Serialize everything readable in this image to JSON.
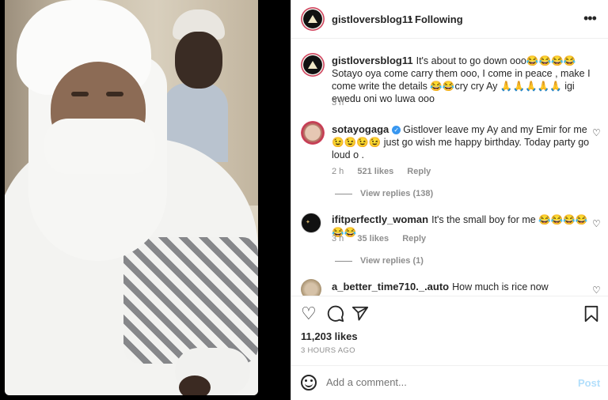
{
  "post": {
    "username": "gistloversblog11",
    "separator": "•",
    "follow_status": "Following",
    "more_icon": "more-horizontal-icon"
  },
  "caption": {
    "username": "gistloversblog11",
    "text": "It's about to go down ooo😂😂😂😂 Sotayo oya come carry them ooo, I come in peace , make I come write the details 😂😂cry cry Ay 🙏🙏🙏🙏🙏 igi ewedu oni wo luwa ooo",
    "time": "3 h"
  },
  "comments": [
    {
      "username": "sotayogaga",
      "verified": true,
      "text": "Gistlover leave my Ay and my Emir for me 😉😉😉😉 just go wish me happy birthday. Today party go loud o .",
      "time": "2 h",
      "likes": "521 likes",
      "reply_label": "Reply",
      "view_replies": "View replies (138)"
    },
    {
      "username": "ifitperfectly_woman",
      "verified": false,
      "text": "It's the small boy for me 😂😂😂😂😂😂",
      "time": "3 h",
      "likes": "35 likes",
      "reply_label": "Reply",
      "view_replies": "View replies (1)"
    },
    {
      "username": "a_better_time710._.auto",
      "verified": false,
      "text": "How much is rice now"
    }
  ],
  "actions": {
    "likes": "11,203 likes",
    "time_ago": "3 HOURS AGO"
  },
  "add_comment": {
    "placeholder": "Add a comment...",
    "post_label": "Post"
  }
}
